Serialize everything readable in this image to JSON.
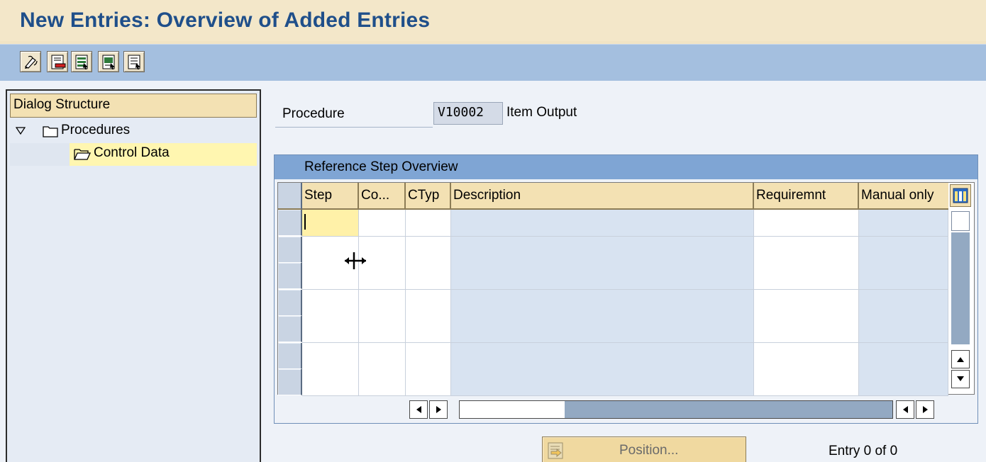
{
  "window": {
    "title": "New Entries: Overview of Added Entries"
  },
  "toolbar": {
    "buttons": [
      {
        "name": "display-change-icon"
      },
      {
        "name": "delete-icon"
      },
      {
        "name": "select-all-icon"
      },
      {
        "name": "select-block-icon"
      },
      {
        "name": "deselect-all-icon"
      }
    ]
  },
  "dialog_structure": {
    "header": "Dialog Structure",
    "items": [
      {
        "label": "Procedures",
        "icon": "folder-closed-icon",
        "expanded": true
      },
      {
        "label": "Control Data",
        "icon": "folder-open-icon",
        "selected": true
      }
    ]
  },
  "procedure": {
    "label": "Procedure",
    "value": "V10002",
    "description": "Item Output"
  },
  "table": {
    "title": "Reference Step Overview",
    "columns": [
      "Step",
      "Co...",
      "CTyp",
      "Description",
      "Requiremnt",
      "Manual only"
    ],
    "rows": [
      [
        "",
        "",
        "",
        "",
        "",
        ""
      ],
      [
        "",
        "",
        "",
        "",
        "",
        ""
      ],
      [
        "",
        "",
        "",
        "",
        "",
        ""
      ],
      [
        "",
        "",
        "",
        "",
        "",
        ""
      ],
      [
        "",
        "",
        "",
        "",
        "",
        ""
      ],
      [
        "",
        "",
        "",
        "",
        "",
        ""
      ],
      [
        "",
        "",
        "",
        "",
        "",
        ""
      ]
    ]
  },
  "footer": {
    "position_button": "Position...",
    "entry_info": "Entry 0 of 0"
  },
  "colors": {
    "title_text": "#1f4f8a",
    "toolbar_bg": "#a4bfdf",
    "header_bg": "#f3e1b3",
    "selection": "#fff6b0",
    "table_title_bg": "#7fa5d4"
  }
}
